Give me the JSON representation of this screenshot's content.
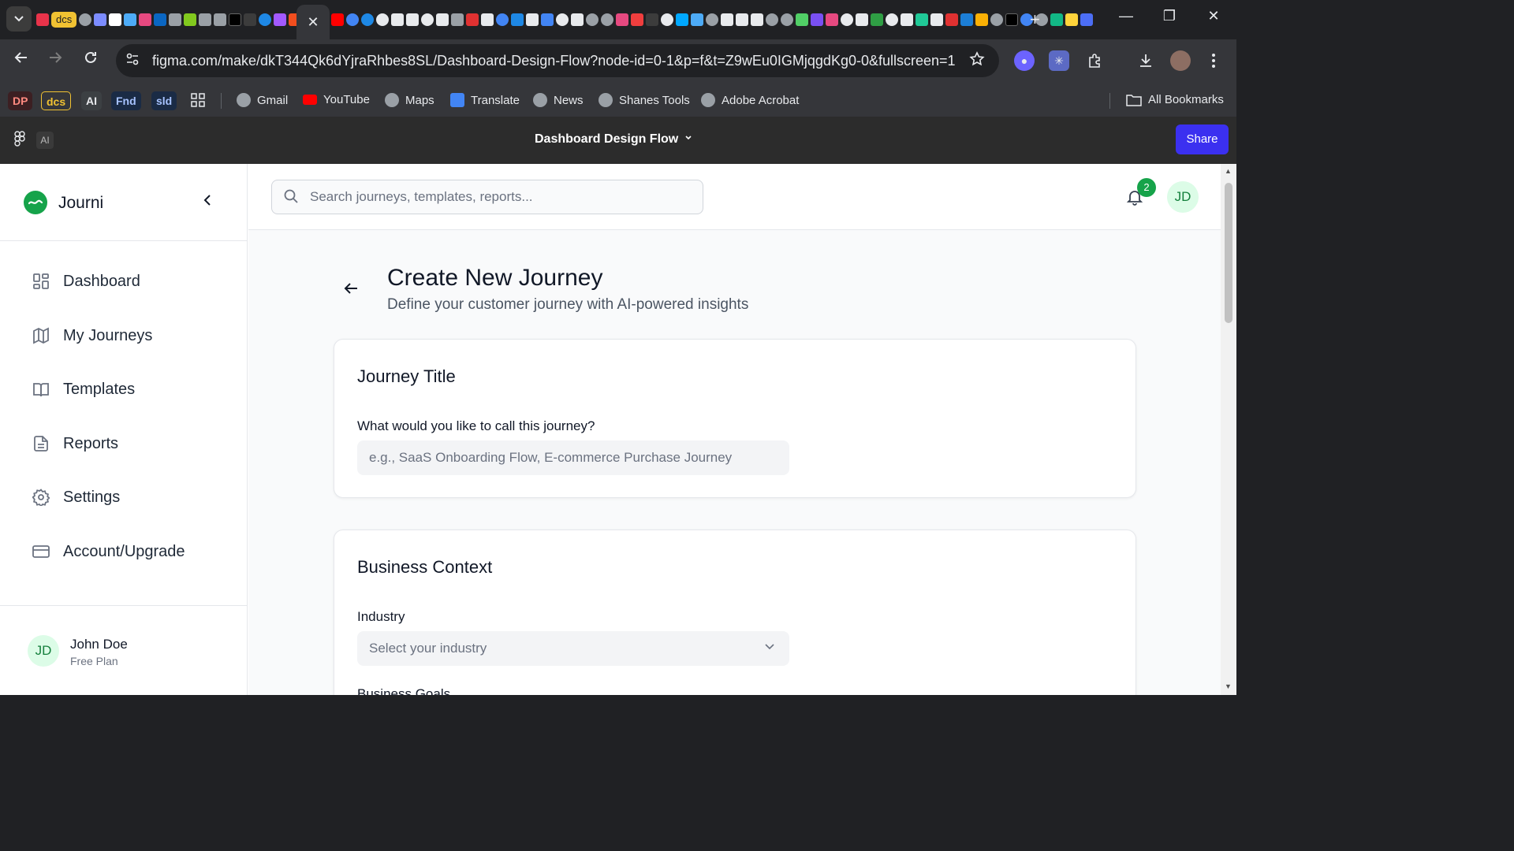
{
  "browser": {
    "active_tab_close": "✕",
    "new_tab": "+",
    "tag_tab": "dcs",
    "url": "figma.com/make/dkT344Qk6dYjraRhbes8SL/Dashboard-Design-Flow?node-id=0-1&p=f&t=Z9wEu0IGMjqgdKg0-0&fullscreen=1",
    "window_controls": {
      "minimize": "—",
      "restore": "❐",
      "close": "✕"
    },
    "bookmarks": {
      "chips": [
        {
          "label": "DP",
          "color": "#ea4335"
        },
        {
          "label": "dcs",
          "color": "#f1c232"
        },
        {
          "label": "AI",
          "color": "#5f6368"
        },
        {
          "label": "Fnd",
          "color": "#1a3d6d"
        },
        {
          "label": "sld",
          "color": "#1a3d6d"
        }
      ],
      "items": [
        "Gmail",
        "YouTube",
        "Maps",
        "Translate",
        "News",
        "Shanes Tools",
        "Adobe Acrobat"
      ],
      "all_bookmarks": "All Bookmarks"
    }
  },
  "figma": {
    "ai_label": "AI",
    "file_title": "Dashboard Design Flow",
    "share_label": "Share"
  },
  "sidebar": {
    "brand": "Journi",
    "items": [
      {
        "label": "Dashboard",
        "icon": "dashboard-icon"
      },
      {
        "label": "My Journeys",
        "icon": "map-icon"
      },
      {
        "label": "Templates",
        "icon": "book-icon"
      },
      {
        "label": "Reports",
        "icon": "file-icon"
      },
      {
        "label": "Settings",
        "icon": "gear-icon"
      },
      {
        "label": "Account/Upgrade",
        "icon": "credit-card-icon"
      }
    ],
    "user": {
      "initials": "JD",
      "name": "John Doe",
      "plan": "Free Plan"
    }
  },
  "topbar": {
    "search_placeholder": "Search journeys, templates, reports...",
    "notification_count": "2",
    "avatar_initials": "JD"
  },
  "page": {
    "title": "Create New Journey",
    "subtitle": "Define your customer journey with AI-powered insights",
    "journey_card": {
      "title": "Journey Title",
      "field_label": "What would you like to call this journey?",
      "field_placeholder": "e.g., SaaS Onboarding Flow, E-commerce Purchase Journey"
    },
    "business_card": {
      "title": "Business Context",
      "industry_label": "Industry",
      "industry_value": "Select your industry",
      "goals_label": "Business Goals"
    }
  },
  "colors": {
    "accent_green": "#16a34a",
    "share_blue": "#3b30f0"
  }
}
